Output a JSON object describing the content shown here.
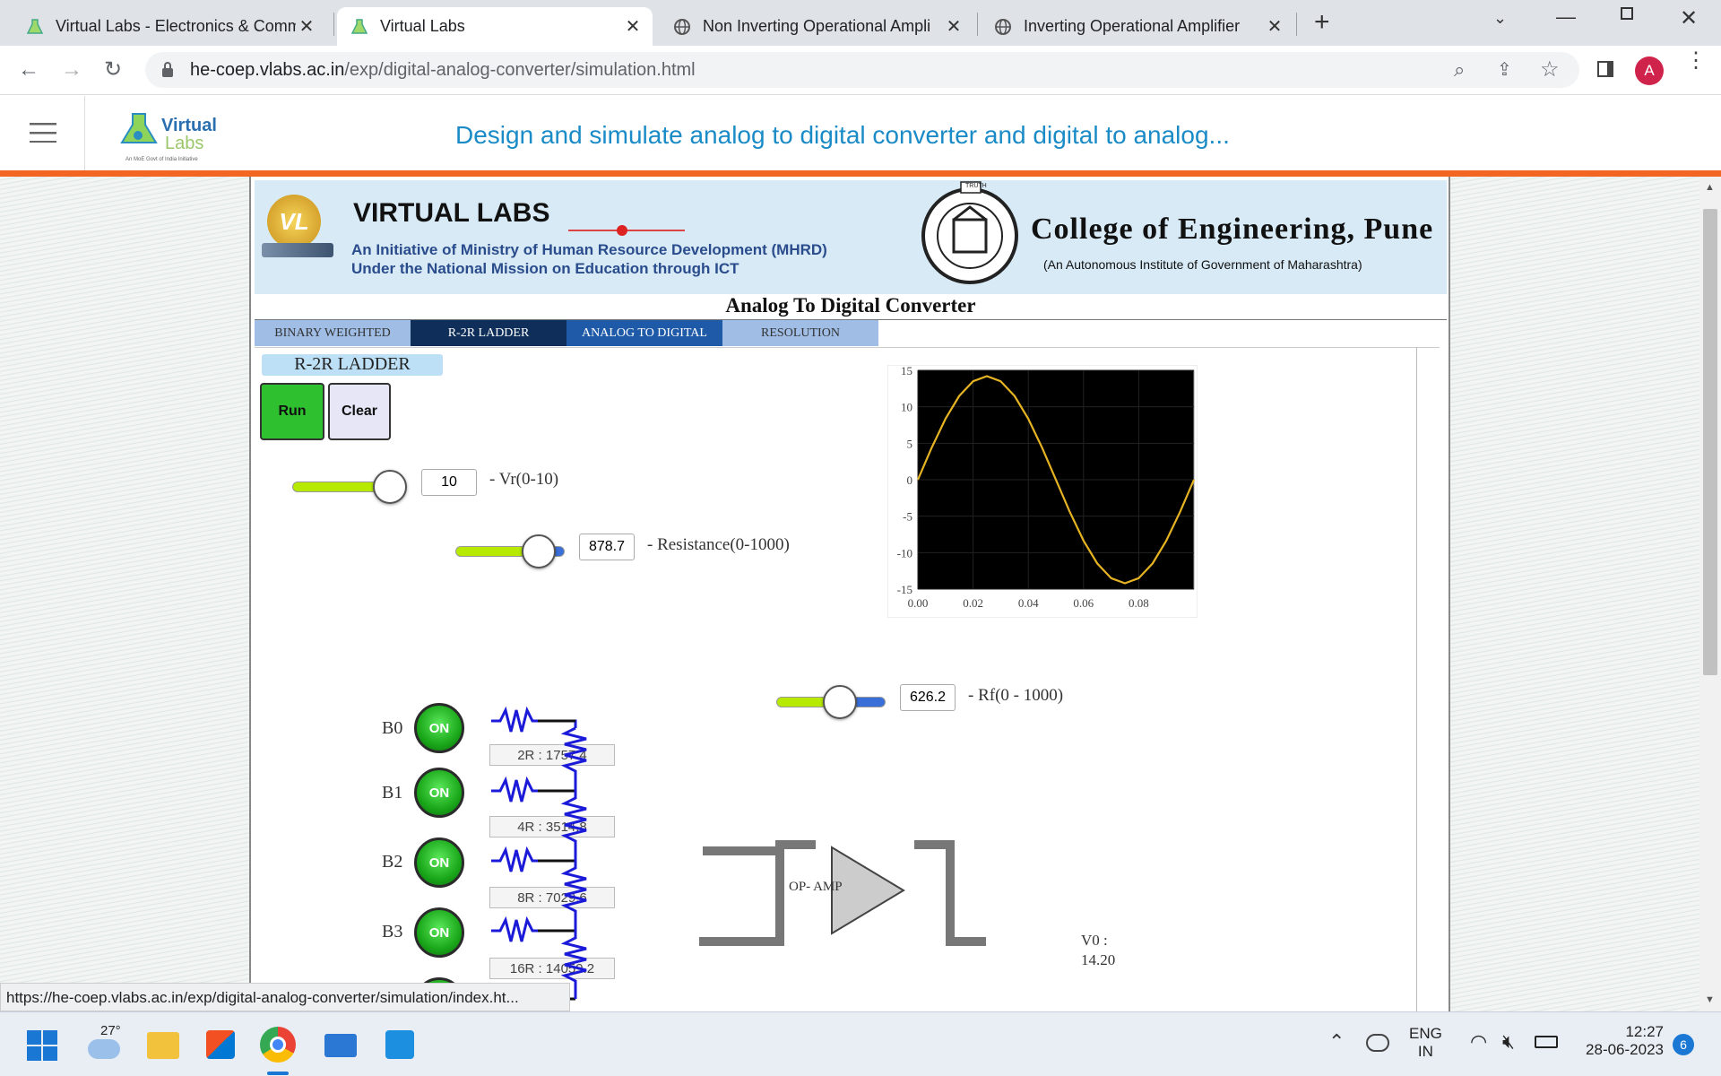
{
  "browser": {
    "tabs": [
      {
        "title": "Virtual Labs - Electronics & Comm",
        "active": false
      },
      {
        "title": "Virtual Labs",
        "active": true
      },
      {
        "title": "Non Inverting Operational Ampli",
        "active": false
      },
      {
        "title": "Inverting Operational Amplifier",
        "active": false
      }
    ],
    "new_tab": "+",
    "url_host": "he-coep.vlabs.ac.in",
    "url_path": "/exp/digital-analog-converter/simulation.html",
    "profile_initial": "A",
    "status_url": "https://he-coep.vlabs.ac.in/exp/digital-analog-converter/simulation/index.ht..."
  },
  "site": {
    "logo_top": "Virtual",
    "logo_bottom": "Labs",
    "logo_tag": "An MoE Govt of India Initiative",
    "page_heading": "Design and simulate analog to digital converter and digital to analog..."
  },
  "banner": {
    "vl_badge": "VL",
    "title": "VIRTUAL LABS",
    "line1": "An Initiative of Ministry of Human Resource Development (MHRD)",
    "line2": "Under the National Mission on Education through ICT",
    "college_name": "College of Engineering, Pune",
    "college_sub": "(An Autonomous Institute of Government of Maharashtra)",
    "seal_text": "TRUTH"
  },
  "sim": {
    "title": "Analog To Digital Converter",
    "tabs": [
      "BINARY WEIGHTED",
      "R-2R LADDER",
      "ANALOG TO DIGITAL",
      "RESOLUTION"
    ],
    "section_label": "R-2R LADDER",
    "run_label": "Run",
    "clear_label": "Clear",
    "vr": {
      "value": "10",
      "label": "- Vr(0-10)",
      "fraction": 0.85
    },
    "resistance": {
      "value": "878.7",
      "label": "- Resistance(0-1000)",
      "fraction": 0.88
    },
    "rf": {
      "value": "626.2",
      "label": "- Rf(0 - 1000)",
      "fraction": 0.63
    },
    "bits": [
      {
        "name": "B0",
        "state": "ON",
        "resistor": "2R : 1757.4"
      },
      {
        "name": "B1",
        "state": "ON",
        "resistor": "4R : 3514.8"
      },
      {
        "name": "B2",
        "state": "ON",
        "resistor": "8R : 7029.6"
      },
      {
        "name": "B3",
        "state": "ON",
        "resistor": "16R : 14059.2"
      }
    ],
    "opamp_label": "OP- AMP",
    "v0_label": "V0 :",
    "v0_value": "14.20"
  },
  "chart_data": {
    "type": "line",
    "title": "",
    "xlabel": "",
    "ylabel": "",
    "xlim": [
      0,
      0.1
    ],
    "ylim": [
      -15,
      15
    ],
    "xticks": [
      "0.00",
      "0.02",
      "0.04",
      "0.06",
      "0.08"
    ],
    "yticks": [
      "15",
      "10",
      "5",
      "0",
      "-5",
      "-10",
      "-15"
    ],
    "background": "#000000",
    "line_color": "#e6b422",
    "series": [
      {
        "x": [
          0,
          0.005,
          0.01,
          0.015,
          0.02,
          0.025,
          0.03,
          0.035,
          0.04,
          0.045,
          0.05,
          0.055,
          0.06,
          0.065,
          0.07,
          0.075,
          0.08,
          0.085,
          0.09,
          0.095,
          0.1
        ],
        "y": [
          0,
          4.39,
          8.35,
          11.49,
          13.5,
          14.2,
          13.5,
          11.49,
          8.35,
          4.39,
          0,
          -4.39,
          -8.35,
          -11.49,
          -13.5,
          -14.2,
          -13.5,
          -11.49,
          -8.35,
          -4.39,
          0
        ]
      }
    ]
  },
  "taskbar": {
    "weather": "27°",
    "lang1": "ENG",
    "lang2": "IN",
    "time": "12:27",
    "date": "28-06-2023",
    "notif_count": "6"
  },
  "colors": {
    "accent": "#1a8bc6",
    "orange": "#f26522",
    "on_green": "#1aa81a"
  }
}
